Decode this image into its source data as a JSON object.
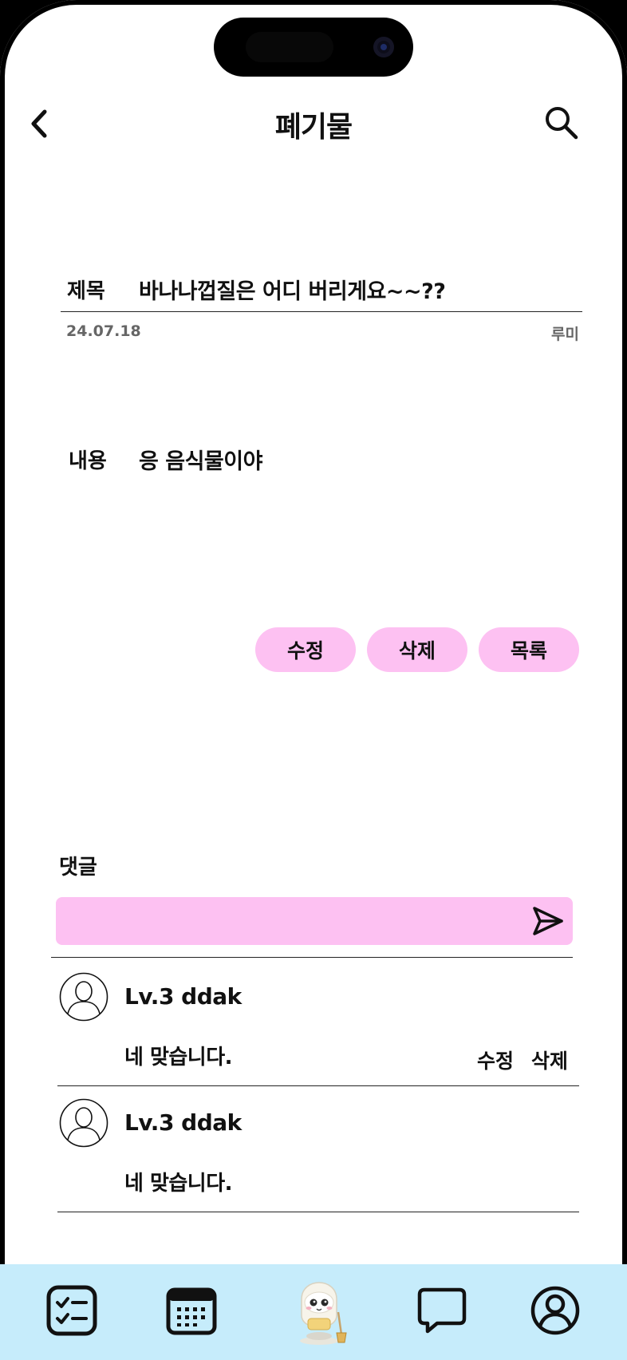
{
  "header": {
    "title": "폐기물"
  },
  "post": {
    "title_label": "제목",
    "title": "바나나껍질은 어디 버리게요~~??",
    "date": "24.07.18",
    "author": "루미",
    "content_label": "내용",
    "content": "응 음식물이야"
  },
  "actions": {
    "edit": "수정",
    "delete": "삭제",
    "list": "목록"
  },
  "comments_section": {
    "heading": "댓글",
    "input_value": "",
    "input_placeholder": ""
  },
  "comments": [
    {
      "author": "Lv.3 ddak",
      "text": "네 맞습니다.",
      "edit": "수정",
      "delete": "삭제"
    },
    {
      "author": "Lv.3 ddak",
      "text": "네 맞습니다."
    }
  ],
  "tabbar": {
    "items": [
      "checklist-icon",
      "calendar-icon",
      "mascot-icon",
      "chat-bubble-icon",
      "profile-icon"
    ]
  },
  "colors": {
    "accent_pink": "#fdc1f2",
    "tabbar_blue": "#c6ecfb"
  }
}
